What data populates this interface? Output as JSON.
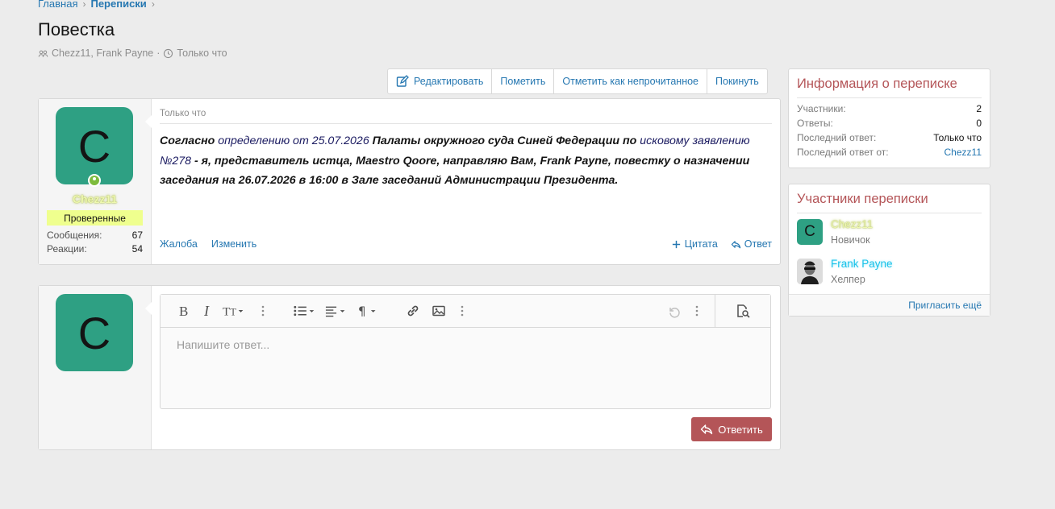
{
  "breadcrumb": {
    "home": "Главная",
    "section": "Переписки"
  },
  "page": {
    "title": "Повестка",
    "participants_text": "Chezz11, Frank Payne",
    "time": "Только что"
  },
  "toolbar": {
    "edit": "Редактировать",
    "mark": "Пометить",
    "mark_unread": "Отметить как непрочитанное",
    "leave": "Покинуть"
  },
  "message": {
    "avatar_letter": "C",
    "author": "Chezz11",
    "user_title": "Проверенные",
    "stats": [
      {
        "label": "Сообщения:",
        "value": "67"
      },
      {
        "label": "Реакции:",
        "value": "54"
      }
    ],
    "date": "Только что",
    "text_parts": {
      "p1": "Согласно ",
      "p2": "определению от 25.07.2026",
      "p3": " Палаты окружного суда Синей Федерации по ",
      "p4": "исковому заявлению №278",
      "p5": " - я, представитель истца, Maestro Qoore, направляю Вам, Frank Payne, повестку о назначении заседания на 26.07.2026 в 16:00 в Зале заседаний Администрации Президента."
    },
    "actions": {
      "report": "Жалоба",
      "edit": "Изменить",
      "quote": "Цитата",
      "reply": "Ответ"
    }
  },
  "reply": {
    "avatar_letter": "C",
    "placeholder": "Напишите ответ...",
    "submit": "Ответить"
  },
  "info": {
    "title": "Информация о переписке",
    "rows": [
      {
        "label": "Участники:",
        "value": "2"
      },
      {
        "label": "Ответы:",
        "value": "0"
      },
      {
        "label": "Последний ответ:",
        "value": "Только что"
      },
      {
        "label": "Последний ответ от:",
        "value": "Chezz11"
      }
    ]
  },
  "participants": {
    "title": "Участники переписки",
    "items": [
      {
        "letter": "C",
        "name": "Chezz11",
        "role": "Новичок"
      },
      {
        "name": "Frank Payne",
        "role": "Хелпер"
      }
    ],
    "invite": "Пригласить ещё"
  }
}
